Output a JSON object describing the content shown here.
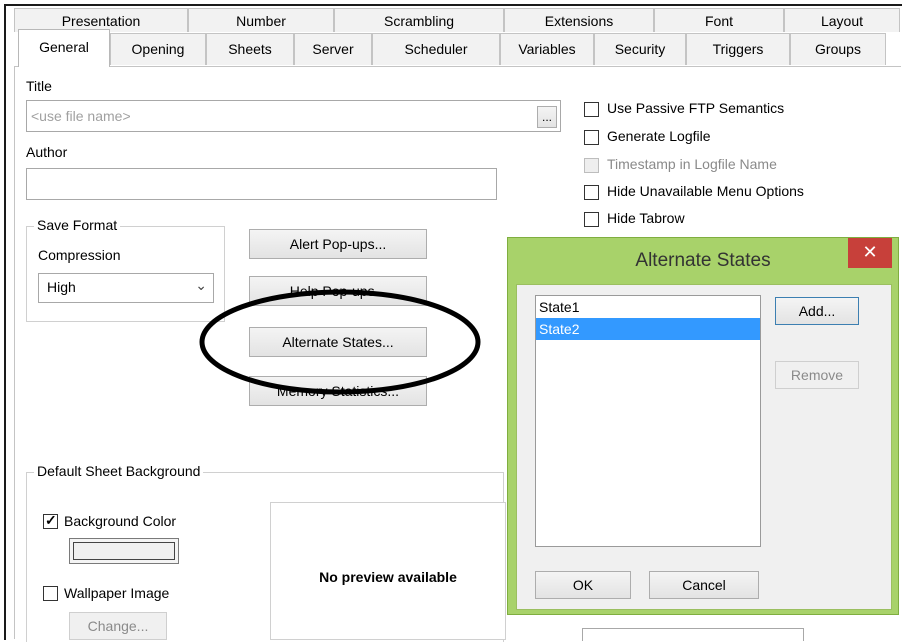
{
  "tabs_row1": [
    "Presentation",
    "Number",
    "Scrambling",
    "Extensions",
    "Font",
    "Layout"
  ],
  "tabs_row2": [
    "General",
    "Opening",
    "Sheets",
    "Server",
    "Scheduler",
    "Variables",
    "Security",
    "Triggers",
    "Groups"
  ],
  "general": {
    "title_label": "Title",
    "title_placeholder": "<use file name>",
    "browse_label": "...",
    "author_label": "Author",
    "author_value": "",
    "save_format_legend": "Save Format",
    "compression_label": "Compression",
    "compression_value": "High",
    "buttons": {
      "alert_popups": "Alert Pop-ups...",
      "help_popups": "Help Pop-ups...",
      "alternate_states": "Alternate States...",
      "memory_statistics": "Memory Statistics..."
    },
    "options": [
      {
        "label": "Use Passive FTP Semantics",
        "checked": false,
        "enabled": true
      },
      {
        "label": "Generate Logfile",
        "checked": false,
        "enabled": true
      },
      {
        "label": "Timestamp in Logfile Name",
        "checked": false,
        "enabled": false
      },
      {
        "label": "Hide Unavailable Menu Options",
        "checked": false,
        "enabled": true
      },
      {
        "label": "Hide Tabrow",
        "checked": false,
        "enabled": true
      }
    ],
    "sheet_background_legend": "Default Sheet Background",
    "background_color_label": "Background Color",
    "background_color_checked": true,
    "wallpaper_label": "Wallpaper Image",
    "wallpaper_checked": false,
    "change_button": "Change...",
    "preview_text": "No preview available"
  },
  "dialog": {
    "title": "Alternate States",
    "close_glyph": "✕",
    "states": [
      "State1",
      "State2"
    ],
    "selected_state": "State2",
    "add_button": "Add...",
    "remove_button": "Remove",
    "ok_button": "OK",
    "cancel_button": "Cancel"
  },
  "colors": {
    "dialog_frame": "#a8d26a",
    "selection": "#3399ff",
    "close_button": "#c7403a",
    "annotation_ellipse": "#000000"
  }
}
